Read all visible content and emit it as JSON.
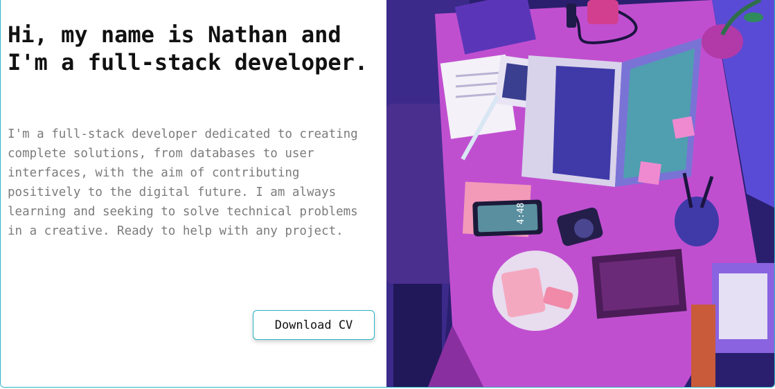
{
  "hero": {
    "headline": "Hi, my name is Nathan and I'm a full-stack developer.",
    "bio": "I'm a full-stack developer dedicated to creating complete solutions, from databases to user interfaces, with the aim of contributing positively to the digital future. I am always learning and seeking to solve technical problems in a creative. Ready to help with any project.",
    "download_label": "Download CV"
  },
  "illustration": {
    "phone_time": "4:48"
  },
  "colors": {
    "accent": "#2bb3c4",
    "headline": "#111111",
    "body_text": "#7b7b7b"
  }
}
